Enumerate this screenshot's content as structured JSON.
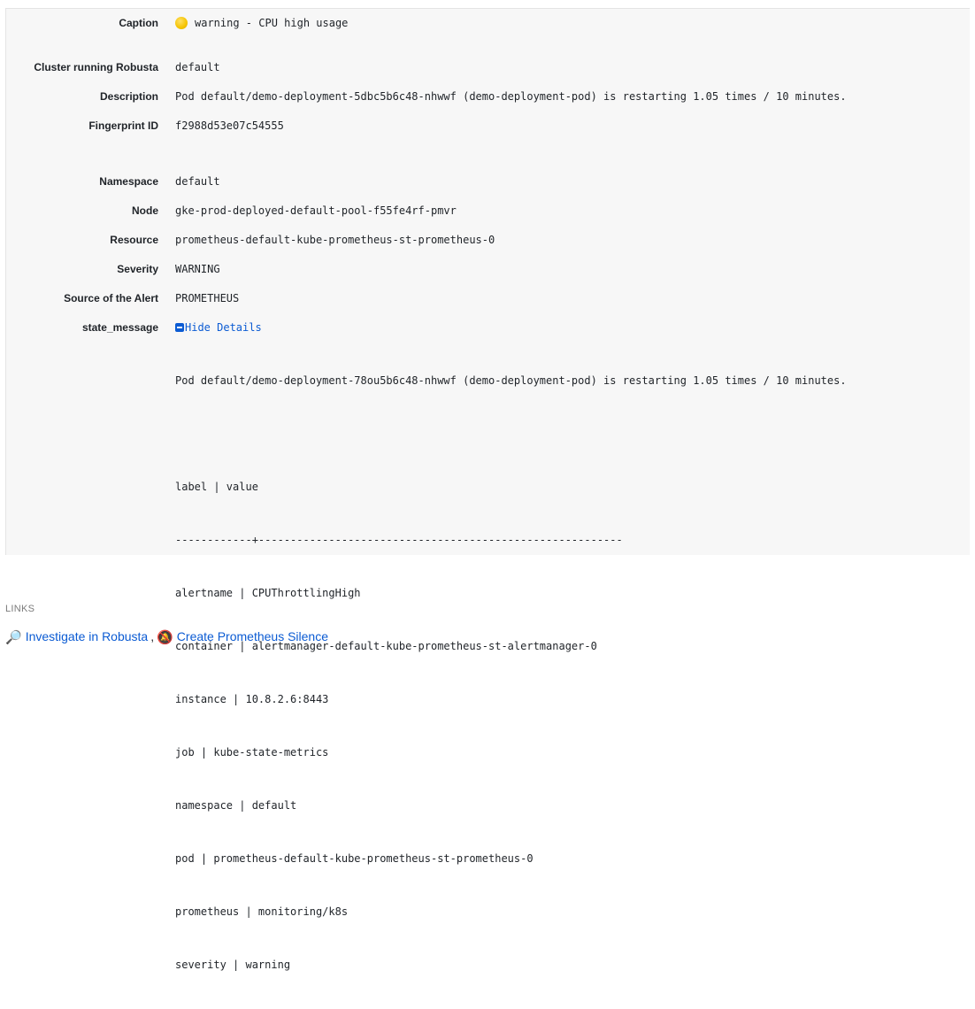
{
  "fields": {
    "caption": {
      "label": "Caption",
      "value": "warning - CPU high usage"
    },
    "cluster": {
      "label": "Cluster running Robusta",
      "value": "default"
    },
    "description": {
      "label": "Description",
      "value": "Pod default/demo-deployment-5dbc5b6c48-nhwwf (demo-deployment-pod) is restarting 1.05 times / 10 minutes."
    },
    "fingerprint": {
      "label": "Fingerprint ID",
      "value": "f2988d53e07c54555"
    },
    "namespace": {
      "label": "Namespace",
      "value": "default"
    },
    "node": {
      "label": "Node",
      "value": "gke-prod-deployed-default-pool-f55fe4rf-pmvr"
    },
    "resource": {
      "label": "Resource",
      "value": "prometheus-default-kube-prometheus-st-prometheus-0"
    },
    "severity": {
      "label": "Severity",
      "value": "WARNING"
    },
    "source": {
      "label": "Source of the Alert",
      "value": "PROMETHEUS"
    },
    "state_message": {
      "label": "state_message",
      "toggle_label": "Hide Details",
      "lines": [
        "Pod default/demo-deployment-78ou5b6c48-nhwwf (demo-deployment-pod) is restarting 1.05 times / 10 minutes.",
        "",
        "label | value",
        "------------+---------------------------------------------------------",
        "alertname | CPUThrottlingHigh",
        "container | alertmanager-default-kube-prometheus-st-alertmanager-0",
        "instance | 10.8.2.6:8443",
        "job | kube-state-metrics",
        "namespace | default",
        "pod | prometheus-default-kube-prometheus-st-prometheus-0",
        "prometheus | monitoring/k8s",
        "severity | warning"
      ]
    }
  },
  "links": {
    "title": "LINKS",
    "items": [
      {
        "label": "Investigate in Robusta",
        "icon": "magnifier-icon"
      },
      {
        "label": "Create Prometheus Silence",
        "icon": "muted-bell-icon"
      }
    ],
    "separator": ","
  },
  "colors": {
    "link": "#0b5bd3",
    "caption_dot": "#f5c400",
    "panel_bg": "#f7f7f7"
  }
}
